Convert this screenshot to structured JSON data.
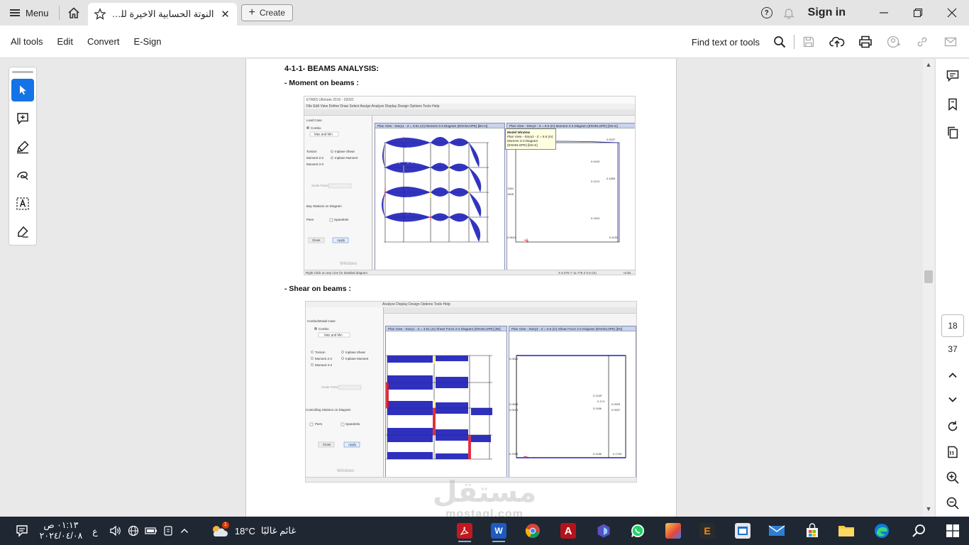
{
  "titlebar": {
    "menu_label": "Menu",
    "tab_title": "النوتة الحسابية الاخيرة للخيمة...",
    "create_label": "Create",
    "sign_in": "Sign in"
  },
  "toolbar": {
    "menus": [
      "All tools",
      "Edit",
      "Convert",
      "E-Sign"
    ],
    "find_label": "Find text or tools"
  },
  "accent_color": "#1473e6",
  "document": {
    "heading": "4-1-1- BEAMS ANALYSIS:",
    "moment_caption": "- Moment on beams :",
    "shear_caption": "- Shear on beams :",
    "moment_shot": {
      "window_title": "ETABS Ultimate 2016 - 02092",
      "menu_bar": "File   Edit   View   Define   Draw   Select   Assign   Analyze   Display   Design   Options   Tools   Help",
      "left_view_tab": "Plan View - Story1 - Z = 3.51 (m)   Moment 3-3 Diagram   (ENVELOPE)  [kN-m]",
      "right_view_tab": "Plan View - Story2 - Z = 6.6 (m)   Moment 3-3 Diagram   (ENVELOPE)  [kN-m]",
      "tooltip_title": "Model Window",
      "tooltip_line1": "Plan View - Story2 - Z = 6.6 (m)",
      "tooltip_line2": "Moment 3-3 Diagram   (ENVELOPE)  [kN-m]",
      "dialog_labels": [
        "Load Case",
        "Combo",
        "Max and Min",
        "Torsion",
        "Inplane Shear",
        "Moment 2-2",
        "Inplane Moment",
        "Moment 3-3",
        "Scale Factor",
        "Bay Stations on Diagram",
        "Piers",
        "Spandrels",
        "Close",
        "Apply"
      ],
      "status_left": "Right Click on any Line for detailed diagram",
      "status_right": "X 5.076  Y 11.776  Z 6.6 (m)",
      "status_units": "Units...",
      "windows_text": "Windows"
    },
    "shear_shot": {
      "left_view_tab": "Plan View - Story1 - Z = 3.51 (m)   Shear Force 2-2 Diagram   (ENVELOPE)  [kN]",
      "right_view_tab": "Plan View - Story2 - Z = 6.6 (m)   Shear Force 2-2 Diagram   (ENVELOPE)  [kN]",
      "menu_bar": "Analyze   Display   Design   Options   Tools   Help",
      "dialog_labels": [
        "Combo/Modal Case",
        "Combo",
        "Max and Min",
        "Torsion",
        "Inplane Shear",
        "Moment 2-2",
        "Inplane Moment",
        "Moment 3-3",
        "Scale Factor",
        "Controlling Stations on Diagram",
        "Piers",
        "Spandrels",
        "Close",
        "Apply"
      ],
      "windows_text": "Windows"
    }
  },
  "right_rail": {
    "current_page": "18",
    "total_pages": "37"
  },
  "taskbar": {
    "clock_time": "٠١:١٣ ص",
    "clock_date": "٢٠٢٤/٠٤/٠٨",
    "lang": "ع",
    "weather_temp": "18°C",
    "weather_desc": "غائم غالبًا",
    "weather_badge": "1"
  },
  "watermark": {
    "arabic": "مستقل",
    "latin": "mostaql.com"
  }
}
